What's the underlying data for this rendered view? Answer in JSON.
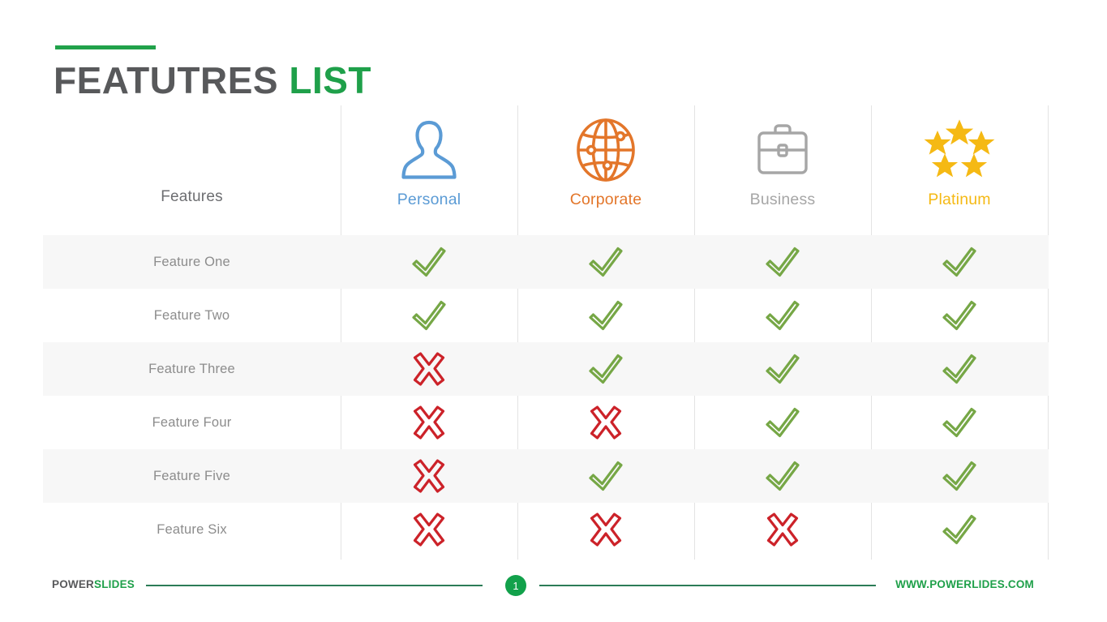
{
  "title": {
    "text_dark": "FEATUTRES",
    "text_accent": "LIST",
    "accent_color": "#1fa04a",
    "dark_color": "#58595b"
  },
  "table": {
    "features_header": "Features",
    "columns": [
      {
        "label": "Personal",
        "icon": "person-icon",
        "color": "#5b9bd5"
      },
      {
        "label": "Corporate",
        "icon": "globe-icon",
        "color": "#e3762a"
      },
      {
        "label": "Business",
        "icon": "briefcase-icon",
        "color": "#a6a6a6"
      },
      {
        "label": "Platinum",
        "icon": "stars-icon",
        "color": "#f5b914"
      }
    ],
    "rows": [
      {
        "label": "Feature One",
        "marks": [
          "check",
          "check",
          "check",
          "check"
        ]
      },
      {
        "label": "Feature Two",
        "marks": [
          "check",
          "check",
          "check",
          "check"
        ]
      },
      {
        "label": "Feature Three",
        "marks": [
          "cross",
          "check",
          "check",
          "check"
        ]
      },
      {
        "label": "Feature Four",
        "marks": [
          "cross",
          "cross",
          "check",
          "check"
        ]
      },
      {
        "label": "Feature Five",
        "marks": [
          "cross",
          "check",
          "check",
          "check"
        ]
      },
      {
        "label": "Feature Six",
        "marks": [
          "cross",
          "cross",
          "cross",
          "check"
        ]
      }
    ],
    "check_color": "#76a746",
    "cross_color": "#cc2229"
  },
  "footer": {
    "brand_dark": "POWER",
    "brand_accent": "SLIDES",
    "page_number": "1",
    "website": "WWW.POWERLIDES.COM"
  }
}
